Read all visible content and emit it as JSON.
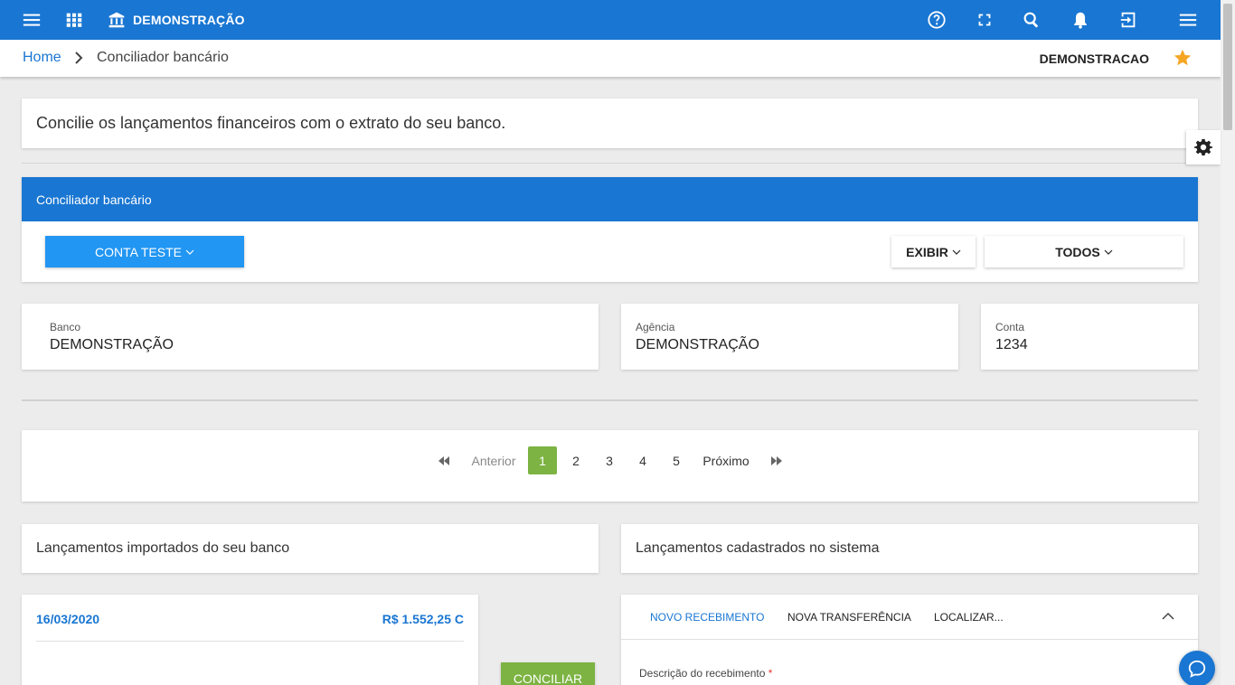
{
  "topbar": {
    "company": "DEMONSTRAÇÃO",
    "icons": [
      "menu-icon",
      "apps-grid-icon",
      "bank-icon",
      "help-icon",
      "fullscreen-icon",
      "search-icon",
      "bell-icon",
      "exit-icon",
      "menu-icon"
    ]
  },
  "breadcrumb": {
    "home": "Home",
    "current": "Conciliador bancário",
    "company": "DEMONSTRACAO"
  },
  "intro": {
    "text": "Concilie os lançamentos financeiros com o extrato do seu banco."
  },
  "panel": {
    "title": "Conciliador bancário",
    "account_button": "CONTA TESTE",
    "show_button": "EXIBIR",
    "filter_button": "TODOS"
  },
  "account_info": {
    "bank_label": "Banco",
    "bank_value": "DEMONSTRAÇÃO",
    "agency_label": "Agência",
    "agency_value": "DEMONSTRAÇÃO",
    "account_label": "Conta",
    "account_value": "1234"
  },
  "pagination": {
    "previous": "Anterior",
    "next": "Próximo",
    "pages": [
      "1",
      "2",
      "3",
      "4",
      "5"
    ],
    "current_page": "1"
  },
  "imported": {
    "title": "Lançamentos importados do seu banco",
    "entry_date": "16/03/2020",
    "entry_amount": "R$ 1.552,25 C"
  },
  "conciliate_button": "CONCILIAR",
  "system": {
    "title": "Lançamentos cadastrados no sistema",
    "tabs": [
      "NOVO RECEBIMENTO",
      "NOVA TRANSFERÊNCIA",
      "LOCALIZAR..."
    ],
    "description_label": "Descrição do recebimento",
    "required_mark": "*"
  },
  "colors": {
    "primary": "#1976d2",
    "account_button": "#2196f3",
    "success": "#7cb342",
    "star": "#f5a623"
  }
}
